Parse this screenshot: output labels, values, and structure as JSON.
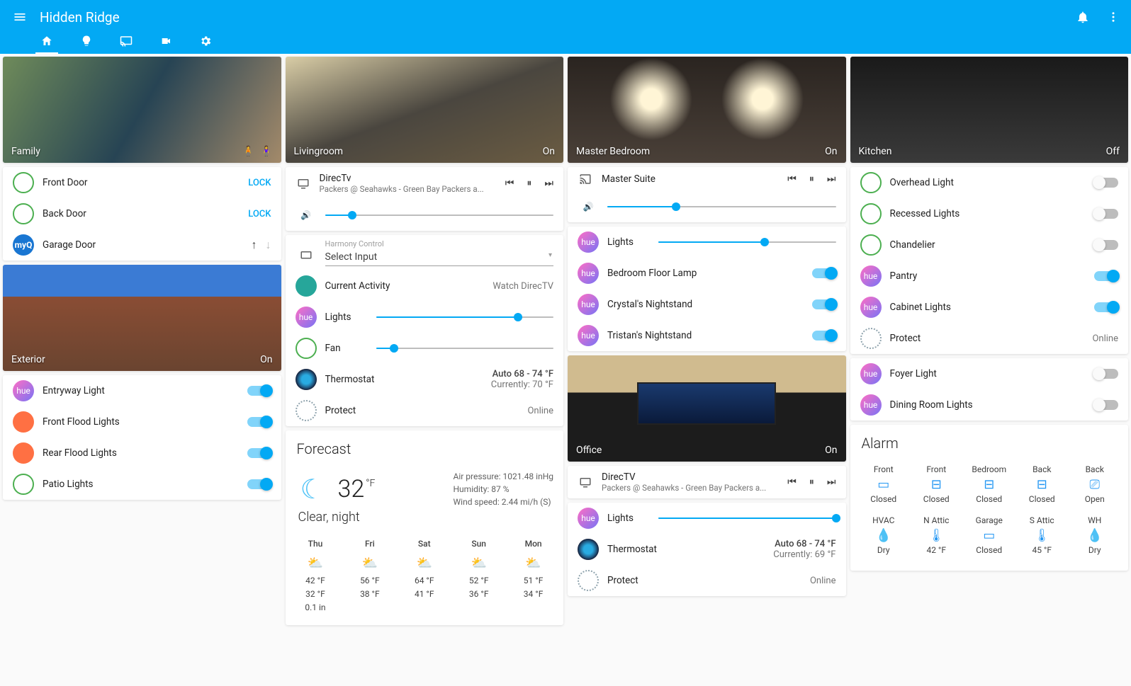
{
  "app": {
    "title": "Hidden Ridge"
  },
  "colors": {
    "primary": "#03a9f4"
  },
  "family": {
    "name": "Family",
    "locks": [
      {
        "label": "Front Door",
        "action": "LOCK"
      },
      {
        "label": "Back Door",
        "action": "LOCK"
      }
    ],
    "garage": {
      "label": "Garage Door"
    }
  },
  "exterior": {
    "name": "Exterior",
    "state": "On",
    "lights": [
      {
        "label": "Entryway Light",
        "on": true,
        "icon": "hue"
      },
      {
        "label": "Front Flood Lights",
        "on": true,
        "icon": "orange"
      },
      {
        "label": "Rear Flood Lights",
        "on": true,
        "icon": "orange"
      },
      {
        "label": "Patio Lights",
        "on": true,
        "icon": "ring"
      }
    ]
  },
  "livingroom": {
    "name": "Livingroom",
    "state": "On",
    "media": {
      "title": "DirecTv",
      "subtitle": "Packers @ Seahawks - Green Bay Packers a...",
      "volume": 12
    },
    "harmony": {
      "section": "Harmony Control",
      "select_label": "Select Input",
      "activity_label": "Current Activity",
      "activity_value": "Watch DirecTV",
      "lights_label": "Lights",
      "lights_level": 80,
      "fan_label": "Fan",
      "fan_level": 10,
      "thermostat_label": "Thermostat",
      "thermostat_line1": "Auto 68 - 74 °F",
      "thermostat_line2": "Currently: 70 °F",
      "protect_label": "Protect",
      "protect_value": "Online"
    }
  },
  "forecast": {
    "title": "Forecast",
    "temp": "32",
    "unit": "°F",
    "condition": "Clear, night",
    "air": "Air pressure: 1021.48 inHg",
    "hum": "Humidity: 87 %",
    "wind": "Wind speed: 2.44 mi/h (S)",
    "days": [
      {
        "name": "Thu",
        "hi": "42 °F",
        "lo": "32 °F",
        "extra": "0.1 in"
      },
      {
        "name": "Fri",
        "hi": "56 °F",
        "lo": "38 °F"
      },
      {
        "name": "Sat",
        "hi": "64 °F",
        "lo": "41 °F"
      },
      {
        "name": "Sun",
        "hi": "52 °F",
        "lo": "36 °F"
      },
      {
        "name": "Mon",
        "hi": "51 °F",
        "lo": "34 °F"
      }
    ]
  },
  "master": {
    "name": "Master Bedroom",
    "state": "On",
    "media": {
      "title": "Master Suite",
      "volume": 30
    },
    "lights": [
      {
        "label": "Lights",
        "type": "slider",
        "level": 60
      },
      {
        "label": "Bedroom Floor Lamp",
        "type": "toggle",
        "on": true
      },
      {
        "label": "Crystal's Nightstand",
        "type": "toggle",
        "on": true
      },
      {
        "label": "Tristan's Nightstand",
        "type": "toggle",
        "on": true
      }
    ]
  },
  "office": {
    "name": "Office",
    "state": "On",
    "media": {
      "title": "DirecTV",
      "subtitle": "Packers @ Seahawks - Green Bay Packers a..."
    },
    "items": {
      "lights_label": "Lights",
      "lights_level": 100,
      "thermostat_label": "Thermostat",
      "thermostat_line1": "Auto 68 - 74 °F",
      "thermostat_line2": "Currently: 69 °F",
      "protect_label": "Protect",
      "protect_value": "Online"
    }
  },
  "kitchen": {
    "name": "Kitchen",
    "state": "Off",
    "lights": [
      {
        "label": "Overhead Light",
        "on": false,
        "icon": "ring"
      },
      {
        "label": "Recessed Lights",
        "on": false,
        "icon": "ring"
      },
      {
        "label": "Chandelier",
        "on": false,
        "icon": "ring"
      },
      {
        "label": "Pantry",
        "on": true,
        "icon": "hue"
      },
      {
        "label": "Cabinet Lights",
        "on": true,
        "icon": "hue"
      }
    ],
    "protect_label": "Protect",
    "protect_value": "Online"
  },
  "adjacent": [
    {
      "label": "Foyer Light",
      "on": false
    },
    {
      "label": "Dining Room Lights",
      "on": false
    }
  ],
  "alarm": {
    "title": "Alarm",
    "sensors": [
      {
        "name": "Front",
        "state": "Closed",
        "icon": "door"
      },
      {
        "name": "Front",
        "state": "Closed",
        "icon": "window"
      },
      {
        "name": "Bedroom",
        "state": "Closed",
        "icon": "window"
      },
      {
        "name": "Back",
        "state": "Closed",
        "icon": "window"
      },
      {
        "name": "Back",
        "state": "Open",
        "icon": "door-open"
      },
      {
        "name": "HVAC",
        "state": "Dry",
        "icon": "drop"
      },
      {
        "name": "N Attic",
        "state": "42 °F",
        "icon": "therm"
      },
      {
        "name": "Garage",
        "state": "Closed",
        "icon": "door"
      },
      {
        "name": "S Attic",
        "state": "45 °F",
        "icon": "therm"
      },
      {
        "name": "WH",
        "state": "Dry",
        "icon": "drop"
      }
    ]
  }
}
